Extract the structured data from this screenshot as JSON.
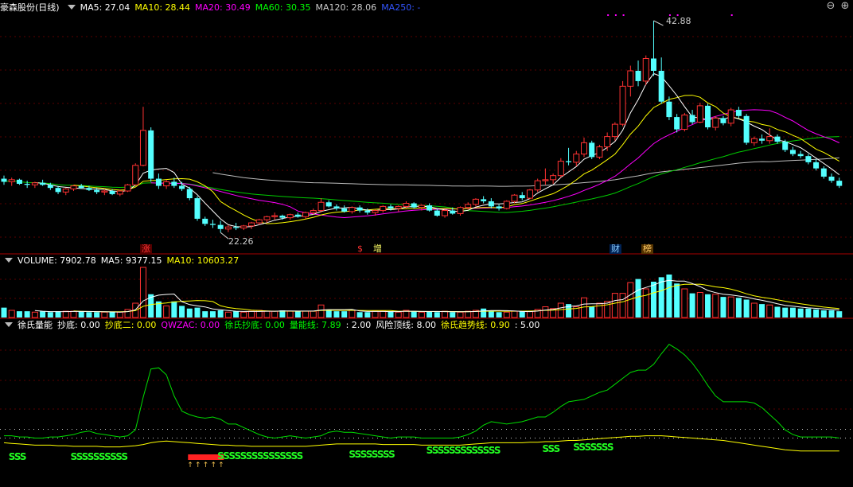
{
  "header": {
    "title": "豪森股份(日线)",
    "ma_labels": [
      {
        "text": "MA5: 27.04",
        "color": "#ffffff"
      },
      {
        "text": "MA10: 28.44",
        "color": "#ffff00"
      },
      {
        "text": "MA20: 30.49",
        "color": "#ff00ff"
      },
      {
        "text": "MA60: 30.35",
        "color": "#00ff00"
      },
      {
        "text": "MA120: 28.06",
        "color": "#cccccc"
      },
      {
        "text": "MA250: -",
        "color": "#3355ff"
      }
    ],
    "controls": {
      "zoom_out": "⊖",
      "zoom_in": "⊕"
    }
  },
  "price_annotations": {
    "high": "42.88",
    "low": "22.26"
  },
  "event_tags": [
    {
      "text": "涨",
      "color": "#ff3333",
      "bg": "#550000"
    },
    {
      "text": "$",
      "color": "#ff3333",
      "bg": ""
    },
    {
      "text": "增",
      "color": "#ffff66",
      "bg": ""
    },
    {
      "text": "财",
      "color": "#88ccff",
      "bg": "#002255"
    },
    {
      "text": "榜",
      "color": "#ffcc66",
      "bg": "#553300"
    }
  ],
  "volume_header": [
    {
      "text": "VOLUME: 7902.78",
      "color": "#ffffff"
    },
    {
      "text": "MA5: 9377.15",
      "color": "#ffffff"
    },
    {
      "text": "MA10: 10603.27",
      "color": "#ffff00"
    }
  ],
  "indicator_header": [
    {
      "text": "徐氏量能",
      "color": "#ffffff"
    },
    {
      "text": "抄底: 0.00",
      "color": "#ffffff"
    },
    {
      "text": "抄底二: 0.00",
      "color": "#ffff00"
    },
    {
      "text": "QWZAC: 0.00",
      "color": "#ff00ff"
    },
    {
      "text": "徐氏抄底: 0.00",
      "color": "#00ff00"
    },
    {
      "text": "量能线: 7.89",
      "color": "#00ff00"
    },
    {
      "text": ": 2.00",
      "color": "#ffffff"
    },
    {
      "text": "风险顶线: 8.00",
      "color": "#ffffff"
    },
    {
      "text": "徐氏趋势线: 0.90",
      "color": "#ffff00"
    },
    {
      "text": ": 5.00",
      "color": "#ffffff"
    }
  ],
  "signal_groups": [
    {
      "text": "SSS"
    },
    {
      "text": "SSSSSSSSSS"
    },
    {
      "text": "SSSSSSSSSSSSSSS"
    },
    {
      "text": "SSSSSSSS"
    },
    {
      "text": "SSSSSSSSSSSSS"
    },
    {
      "text": "SSS"
    },
    {
      "text": "SSSSSSS"
    }
  ],
  "chart_data": {
    "type": "candlestick",
    "title": "豪森股份(日线)",
    "y_markers": {
      "high": 42.88,
      "low": 22.26
    },
    "candles": [
      [
        27.5,
        27.8,
        26.9,
        27.2
      ],
      [
        27.2,
        27.6,
        26.8,
        27.4
      ],
      [
        27.4,
        27.5,
        26.9,
        27.0
      ],
      [
        27.0,
        27.3,
        26.6,
        26.9
      ],
      [
        26.9,
        27.2,
        26.6,
        27.1
      ],
      [
        27.1,
        27.4,
        26.8,
        26.9
      ],
      [
        26.9,
        27.1,
        26.4,
        26.6
      ],
      [
        26.6,
        26.8,
        26.0,
        26.2
      ],
      [
        26.2,
        26.6,
        25.9,
        26.5
      ],
      [
        26.5,
        26.9,
        26.3,
        26.8
      ],
      [
        26.8,
        27.0,
        26.5,
        26.6
      ],
      [
        26.6,
        26.8,
        26.3,
        26.4
      ],
      [
        26.4,
        26.6,
        26.0,
        26.2
      ],
      [
        26.2,
        26.5,
        25.9,
        26.3
      ],
      [
        26.3,
        26.5,
        25.9,
        26.0
      ],
      [
        26.0,
        26.4,
        25.8,
        26.3
      ],
      [
        26.3,
        27.0,
        26.2,
        26.9
      ],
      [
        26.9,
        29.0,
        26.8,
        28.8
      ],
      [
        28.8,
        34.5,
        28.7,
        32.2
      ],
      [
        32.2,
        32.5,
        27.2,
        27.5
      ],
      [
        27.5,
        28.0,
        26.5,
        26.8
      ],
      [
        26.8,
        27.4,
        26.5,
        27.2
      ],
      [
        27.2,
        27.6,
        26.6,
        26.8
      ],
      [
        26.8,
        27.2,
        26.3,
        26.5
      ],
      [
        26.5,
        26.7,
        25.4,
        25.6
      ],
      [
        25.6,
        25.8,
        23.4,
        23.6
      ],
      [
        23.6,
        23.8,
        22.9,
        23.1
      ],
      [
        23.1,
        23.5,
        22.7,
        23.0
      ],
      [
        23.0,
        23.4,
        22.26,
        22.6
      ],
      [
        22.6,
        23.0,
        22.3,
        22.8
      ],
      [
        22.8,
        23.2,
        22.5,
        22.7
      ],
      [
        22.7,
        23.0,
        22.5,
        22.9
      ],
      [
        22.9,
        23.3,
        22.6,
        23.2
      ],
      [
        23.2,
        23.6,
        23.0,
        23.5
      ],
      [
        23.5,
        23.9,
        23.2,
        23.8
      ],
      [
        23.8,
        24.2,
        23.5,
        23.9
      ],
      [
        23.9,
        24.0,
        23.5,
        23.7
      ],
      [
        23.7,
        24.1,
        23.5,
        24.0
      ],
      [
        24.0,
        24.2,
        23.7,
        23.8
      ],
      [
        23.8,
        24.3,
        23.6,
        24.2
      ],
      [
        24.2,
        24.6,
        24.0,
        24.4
      ],
      [
        24.4,
        25.6,
        24.2,
        25.2
      ],
      [
        25.2,
        25.4,
        24.7,
        24.8
      ],
      [
        24.8,
        25.0,
        24.4,
        24.6
      ],
      [
        24.6,
        24.9,
        24.2,
        24.3
      ],
      [
        24.3,
        24.8,
        24.1,
        24.7
      ],
      [
        24.7,
        24.9,
        24.2,
        24.4
      ],
      [
        24.4,
        24.6,
        24.0,
        24.2
      ],
      [
        24.2,
        24.5,
        23.9,
        24.4
      ],
      [
        24.4,
        24.9,
        24.2,
        24.8
      ],
      [
        24.8,
        25.0,
        24.4,
        24.6
      ],
      [
        24.6,
        24.9,
        24.3,
        24.8
      ],
      [
        24.8,
        25.3,
        24.6,
        25.1
      ],
      [
        25.1,
        25.2,
        24.6,
        24.7
      ],
      [
        24.7,
        25.0,
        24.4,
        24.9
      ],
      [
        24.9,
        25.1,
        24.3,
        24.4
      ],
      [
        24.4,
        24.6,
        23.8,
        23.9
      ],
      [
        23.9,
        24.5,
        23.7,
        24.4
      ],
      [
        24.4,
        24.7,
        24.0,
        24.1
      ],
      [
        24.1,
        24.8,
        23.9,
        24.7
      ],
      [
        24.7,
        25.2,
        24.5,
        25.0
      ],
      [
        25.0,
        25.6,
        24.8,
        25.5
      ],
      [
        25.5,
        25.8,
        25.1,
        25.3
      ],
      [
        25.3,
        25.6,
        24.6,
        24.8
      ],
      [
        24.8,
        25.0,
        24.4,
        24.6
      ],
      [
        24.6,
        25.4,
        24.5,
        25.3
      ],
      [
        25.3,
        26.0,
        25.1,
        25.9
      ],
      [
        25.9,
        26.2,
        25.4,
        25.6
      ],
      [
        25.6,
        26.5,
        25.5,
        26.4
      ],
      [
        26.4,
        27.5,
        26.2,
        27.3
      ],
      [
        27.3,
        28.5,
        26.9,
        27.4
      ],
      [
        27.4,
        28.0,
        27.0,
        27.8
      ],
      [
        27.8,
        29.5,
        27.6,
        29.2
      ],
      [
        29.2,
        30.5,
        28.8,
        29.1
      ],
      [
        29.1,
        30.2,
        28.7,
        29.9
      ],
      [
        29.9,
        31.5,
        29.6,
        31.0
      ],
      [
        31.0,
        31.2,
        29.4,
        29.6
      ],
      [
        29.6,
        30.8,
        29.4,
        30.6
      ],
      [
        30.6,
        32.0,
        30.2,
        31.6
      ],
      [
        31.6,
        33.0,
        31.2,
        32.8
      ],
      [
        32.8,
        37.0,
        32.6,
        36.5
      ],
      [
        36.5,
        38.5,
        35.5,
        38.0
      ],
      [
        38.0,
        39.0,
        36.5,
        37.0
      ],
      [
        37.0,
        39.5,
        36.6,
        39.2
      ],
      [
        39.2,
        42.88,
        37.5,
        38.0
      ],
      [
        38.0,
        39.3,
        34.8,
        35.0
      ],
      [
        35.0,
        35.5,
        33.2,
        33.5
      ],
      [
        33.5,
        33.8,
        32.0,
        32.3
      ],
      [
        32.3,
        33.9,
        32.1,
        33.7
      ],
      [
        33.7,
        34.2,
        32.8,
        33.0
      ],
      [
        33.0,
        34.9,
        32.9,
        34.6
      ],
      [
        34.6,
        34.8,
        32.3,
        32.5
      ],
      [
        32.5,
        33.6,
        32.2,
        33.4
      ],
      [
        33.4,
        33.6,
        32.7,
        32.9
      ],
      [
        32.9,
        34.4,
        32.6,
        34.2
      ],
      [
        34.2,
        34.5,
        33.4,
        33.6
      ],
      [
        33.6,
        33.8,
        30.8,
        31.0
      ],
      [
        31.0,
        31.6,
        30.7,
        31.4
      ],
      [
        31.4,
        31.8,
        30.9,
        31.2
      ],
      [
        31.2,
        32.4,
        30.9,
        31.6
      ],
      [
        31.6,
        31.8,
        30.9,
        31.1
      ],
      [
        31.1,
        31.3,
        30.1,
        30.3
      ],
      [
        30.3,
        30.6,
        29.7,
        29.9
      ],
      [
        29.9,
        30.2,
        29.5,
        29.7
      ],
      [
        29.7,
        29.9,
        28.9,
        29.1
      ],
      [
        29.1,
        29.4,
        28.3,
        28.5
      ],
      [
        28.5,
        28.7,
        27.5,
        27.7
      ],
      [
        27.7,
        28.0,
        27.1,
        27.3
      ],
      [
        27.3,
        27.6,
        26.6,
        26.8
      ]
    ],
    "volume_header_values": {
      "volume": 7902.78,
      "ma5": 9377.15,
      "ma10": 10603.27
    },
    "volume_note": "hist volumes estimated as relative magnitudes",
    "volumes": [
      1.1,
      0.8,
      0.7,
      0.7,
      0.6,
      0.7,
      0.6,
      0.7,
      0.7,
      0.7,
      0.7,
      0.6,
      0.6,
      0.6,
      0.6,
      0.6,
      0.9,
      1.6,
      5.6,
      2.6,
      1.8,
      1.3,
      1.8,
      1.3,
      1.0,
      1.1,
      0.7,
      0.7,
      0.8,
      0.6,
      0.7,
      0.6,
      0.7,
      0.8,
      0.7,
      0.7,
      0.8,
      0.7,
      0.7,
      0.7,
      0.7,
      1.4,
      0.9,
      0.7,
      0.7,
      0.8,
      0.6,
      0.6,
      0.7,
      0.7,
      0.7,
      0.6,
      0.8,
      0.7,
      0.6,
      0.7,
      0.6,
      0.7,
      0.6,
      0.6,
      0.7,
      0.8,
      1.0,
      0.8,
      0.6,
      0.6,
      0.7,
      0.7,
      0.7,
      0.9,
      1.2,
      1.0,
      1.6,
      1.5,
      1.2,
      2.2,
      1.2,
      1.6,
      1.8,
      2.7,
      2.7,
      3.9,
      4.3,
      3.2,
      4.0,
      4.5,
      4.8,
      3.8,
      3.2,
      2.7,
      2.8,
      2.6,
      2.6,
      2.3,
      2.3,
      2.2,
      2.0,
      1.6,
      1.5,
      1.4,
      1.2,
      1.1,
      1.1,
      1.0,
      1.0,
      0.9,
      0.8,
      0.8,
      0.7
    ],
    "indicator_line": [
      2.2,
      2.2,
      2.1,
      2.1,
      2.0,
      2.0,
      2.1,
      2.1,
      2.2,
      2.3,
      2.5,
      2.6,
      2.4,
      2.3,
      2.2,
      2.1,
      2.2,
      2.7,
      5.5,
      7.9,
      8.0,
      7.4,
      5.6,
      4.3,
      4.0,
      3.8,
      3.7,
      3.8,
      3.6,
      3.2,
      3.2,
      2.9,
      2.6,
      2.3,
      2.1,
      2.0,
      2.1,
      2.2,
      2.1,
      2.0,
      2.1,
      2.2,
      2.5,
      2.6,
      2.5,
      2.5,
      2.4,
      2.3,
      2.2,
      2.1,
      2.0,
      2.1,
      2.1,
      2.1,
      2.0,
      2.0,
      2.0,
      2.0,
      2.0,
      2.1,
      2.3,
      2.6,
      3.1,
      3.4,
      3.3,
      3.2,
      3.3,
      3.4,
      3.6,
      3.8,
      3.8,
      4.2,
      4.7,
      5.1,
      5.2,
      5.3,
      5.6,
      5.9,
      6.1,
      6.6,
      7.1,
      7.6,
      7.8,
      7.8,
      8.3,
      9.2,
      10.0,
      9.6,
      9.1,
      8.4,
      7.5,
      6.5,
      5.6,
      5.1,
      5.1,
      5.1,
      5.1,
      5.0,
      4.6,
      4.0,
      3.4,
      2.7,
      2.3,
      2.1,
      2.1,
      2.1,
      2.1,
      2.1,
      2.0
    ],
    "trend_line": [
      1.6,
      1.55,
      1.5,
      1.45,
      1.4,
      1.4,
      1.4,
      1.35,
      1.35,
      1.3,
      1.3,
      1.3,
      1.3,
      1.25,
      1.25,
      1.25,
      1.3,
      1.35,
      1.45,
      1.6,
      1.7,
      1.75,
      1.7,
      1.65,
      1.6,
      1.55,
      1.5,
      1.45,
      1.4,
      1.4,
      1.35,
      1.35,
      1.3,
      1.3,
      1.3,
      1.3,
      1.3,
      1.3,
      1.3,
      1.3,
      1.35,
      1.4,
      1.45,
      1.5,
      1.5,
      1.5,
      1.5,
      1.5,
      1.5,
      1.45,
      1.45,
      1.45,
      1.45,
      1.45,
      1.4,
      1.4,
      1.4,
      1.4,
      1.4,
      1.4,
      1.45,
      1.5,
      1.55,
      1.6,
      1.6,
      1.6,
      1.6,
      1.6,
      1.65,
      1.65,
      1.7,
      1.7,
      1.75,
      1.8,
      1.8,
      1.85,
      1.9,
      1.95,
      2.0,
      2.05,
      2.1,
      2.15,
      2.15,
      2.2,
      2.2,
      2.2,
      2.15,
      2.1,
      2.05,
      2.0,
      1.95,
      1.9,
      1.85,
      1.8,
      1.7,
      1.6,
      1.5,
      1.4,
      1.3,
      1.2,
      1.1,
      1.0,
      0.95,
      0.9,
      0.9,
      0.9,
      0.9,
      0.9,
      0.9
    ],
    "reference_lines": {
      "level_2": 2.0,
      "level_5": 5.0,
      "risk_top": 8.0
    },
    "signal_ranges": [
      [
        1,
        4
      ],
      [
        9,
        18
      ],
      [
        28,
        42
      ],
      [
        45,
        52
      ],
      [
        55,
        66
      ],
      [
        70,
        73
      ],
      [
        74,
        80
      ]
    ]
  }
}
